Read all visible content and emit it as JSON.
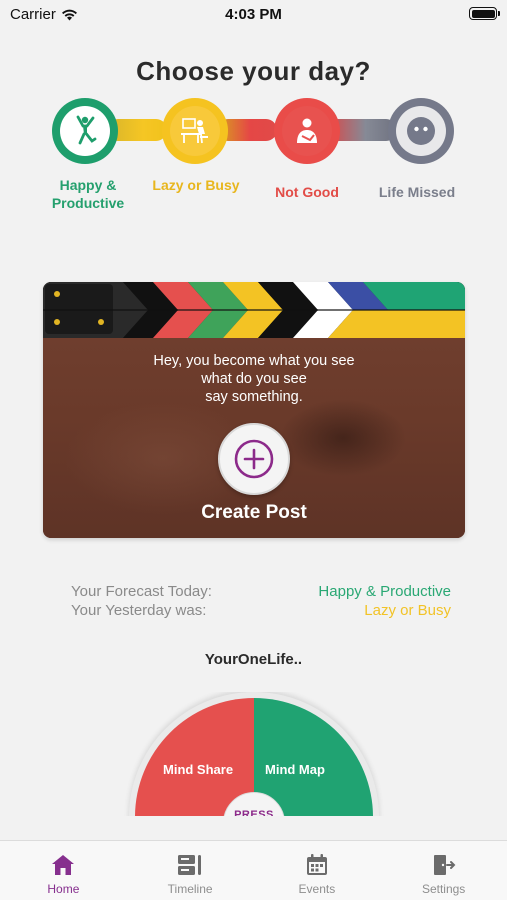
{
  "status_bar": {
    "carrier": "Carrier",
    "time": "4:03 PM"
  },
  "title": "Choose your day?",
  "moods": [
    {
      "label": "Happy & Productive",
      "color": "#25a06e",
      "icon": "jumping-person-icon"
    },
    {
      "label": "Lazy or Busy",
      "color": "#e8b61d",
      "icon": "person-at-desk-icon"
    },
    {
      "label": "Not Good",
      "color": "#e24c47",
      "icon": "sick-person-icon"
    },
    {
      "label": "Life Missed",
      "color": "#7a7e8b",
      "icon": "blank-face-icon"
    }
  ],
  "card": {
    "message_line1": "Hey, you become what you see",
    "message_line2": "what do you see",
    "message_line3": "say something.",
    "button_label": "Create Post"
  },
  "forecast": {
    "today_label": "Your Forecast Today:",
    "today_value": "Happy & Productive",
    "yesterday_label": "Your Yesterday was:",
    "yesterday_value": "Lazy or Busy"
  },
  "section_title": "YourOneLife..",
  "wheel": {
    "left_label": "Mind Share",
    "right_label": "Mind Map",
    "center_label": "PRESS"
  },
  "tabs": [
    {
      "label": "Home",
      "icon": "home-icon",
      "active": true
    },
    {
      "label": "Timeline",
      "icon": "timeline-icon",
      "active": false
    },
    {
      "label": "Events",
      "icon": "calendar-icon",
      "active": false
    },
    {
      "label": "Settings",
      "icon": "exit-door-icon",
      "active": false
    }
  ],
  "colors": {
    "accent": "#862f8e",
    "happy": "#25a06e",
    "lazy": "#f2c327",
    "not_good": "#e24c47",
    "missed": "#7a7e8b"
  }
}
